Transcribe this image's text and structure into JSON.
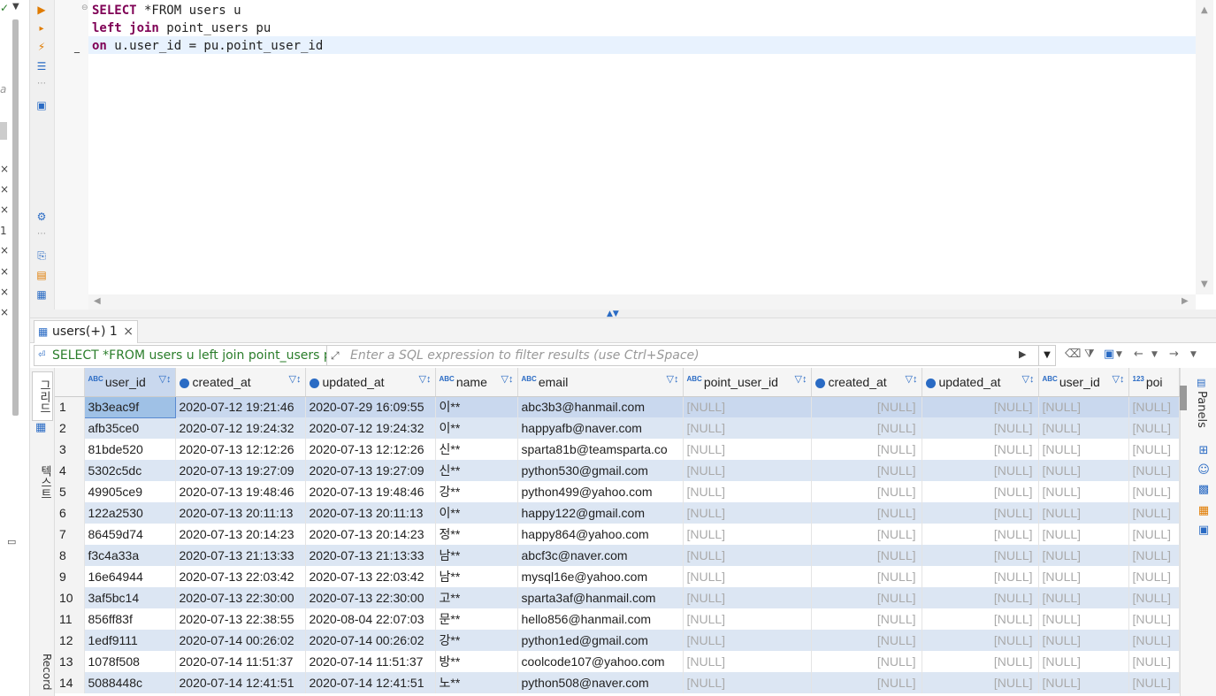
{
  "editor": {
    "lines": [
      {
        "kw": "SELECT",
        "rest": " *FROM users u"
      },
      {
        "kw": "left join",
        "rest": " point_users pu"
      },
      {
        "kw": "on",
        "rest": " u.user_id = pu.point_user_id"
      }
    ]
  },
  "results_tab": {
    "label": "users(+) 1"
  },
  "filter": {
    "sql": "SELECT *FROM users u left join point_users p",
    "placeholder": "Enter a SQL expression to filter results (use Ctrl+Space)"
  },
  "side_tabs": {
    "grid": "그리드",
    "text": "텍스트",
    "record": "Record"
  },
  "right_panel": {
    "label": "Panels"
  },
  "grid": {
    "columns": [
      "user_id",
      "created_at",
      "updated_at",
      "name",
      "email",
      "point_user_id",
      "created_at",
      "updated_at",
      "user_id",
      "poi"
    ],
    "column_types": [
      "ABC",
      "date",
      "date",
      "ABC",
      "ABC",
      "ABC",
      "date",
      "date",
      "ABC",
      "123"
    ],
    "null_text": "[NULL]",
    "rows": [
      [
        "1",
        "3b3eac9f",
        "2020-07-12 19:21:46",
        "2020-07-29 16:09:55",
        "이**",
        "abc3b3@hanmail.com"
      ],
      [
        "2",
        "afb35ce0",
        "2020-07-12 19:24:32",
        "2020-07-12 19:24:32",
        "이**",
        "happyafb@naver.com"
      ],
      [
        "3",
        "81bde520",
        "2020-07-13 12:12:26",
        "2020-07-13 12:12:26",
        "신**",
        "sparta81b@teamsparta.co"
      ],
      [
        "4",
        "5302c5dc",
        "2020-07-13 19:27:09",
        "2020-07-13 19:27:09",
        "신**",
        "python530@gmail.com"
      ],
      [
        "5",
        "49905ce9",
        "2020-07-13 19:48:46",
        "2020-07-13 19:48:46",
        "강**",
        "python499@yahoo.com"
      ],
      [
        "6",
        "122a2530",
        "2020-07-13 20:11:13",
        "2020-07-13 20:11:13",
        "이**",
        "happy122@gmail.com"
      ],
      [
        "7",
        "86459d74",
        "2020-07-13 20:14:23",
        "2020-07-13 20:14:23",
        "정**",
        "happy864@yahoo.com"
      ],
      [
        "8",
        "f3c4a33a",
        "2020-07-13 21:13:33",
        "2020-07-13 21:13:33",
        "남**",
        "abcf3c@naver.com"
      ],
      [
        "9",
        "16e64944",
        "2020-07-13 22:03:42",
        "2020-07-13 22:03:42",
        "남**",
        "mysql16e@yahoo.com"
      ],
      [
        "10",
        "3af5bc14",
        "2020-07-13 22:30:00",
        "2020-07-13 22:30:00",
        "고**",
        "sparta3af@hanmail.com"
      ],
      [
        "11",
        "856ff83f",
        "2020-07-13 22:38:55",
        "2020-08-04 22:07:03",
        "문**",
        "hello856@hanmail.com"
      ],
      [
        "12",
        "1edf9111",
        "2020-07-14 00:26:02",
        "2020-07-14 00:26:02",
        "강**",
        "python1ed@gmail.com"
      ],
      [
        "13",
        "1078f508",
        "2020-07-14 11:51:37",
        "2020-07-14 11:51:37",
        "방**",
        "coolcode107@yahoo.com"
      ],
      [
        "14",
        "5088448c",
        "2020-07-14 12:41:51",
        "2020-07-14 12:41:51",
        "노**",
        "python508@naver.com"
      ]
    ]
  }
}
